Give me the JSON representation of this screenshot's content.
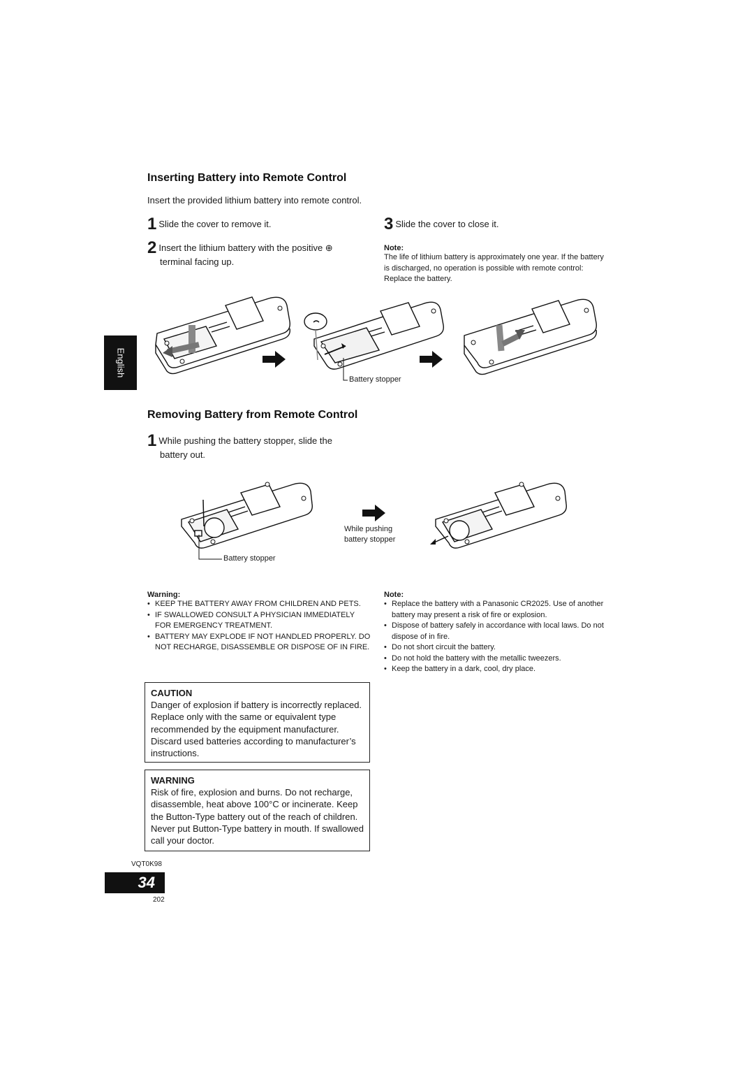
{
  "insert_section": {
    "title": "Inserting Battery into Remote Control",
    "intro": "Insert the provided lithium battery into remote control.",
    "steps": [
      {
        "num": "1",
        "text": "Slide the cover to remove it."
      },
      {
        "num": "2",
        "text_line1": "Insert the lithium battery with the positive ⊕",
        "text_line2": "terminal facing up."
      },
      {
        "num": "3",
        "text": "Slide the cover to close it."
      }
    ],
    "note": {
      "title": "Note:",
      "text": "The life of lithium battery is approximately one year. If the battery is discharged, no operation is possible with remote control: Replace the battery."
    },
    "figure_labels": {
      "battery_stopper": "Battery stopper"
    }
  },
  "language_tab": "English",
  "remove_section": {
    "title": "Removing Battery from Remote Control",
    "steps": [
      {
        "num": "1",
        "text_line1": "While pushing the battery stopper, slide the",
        "text_line2": "battery out."
      }
    ],
    "figure_labels": {
      "battery_stopper": "Battery stopper",
      "while_pushing_line1": "While pushing",
      "while_pushing_line2": "battery stopper"
    }
  },
  "warning_list": {
    "title": "Warning:",
    "items": [
      "KEEP THE BATTERY AWAY FROM CHILDREN AND PETS.",
      "IF SWALLOWED CONSULT A PHYSICIAN IMMEDIATELY FOR EMERGENCY TREATMENT.",
      "BATTERY MAY EXPLODE IF NOT HANDLED PROPERLY. DO NOT RECHARGE, DISASSEMBLE OR DISPOSE OF IN FIRE."
    ]
  },
  "note_list": {
    "title": "Note:",
    "items": [
      "Replace the battery with a Panasonic CR2025. Use of another battery may present a risk of fire or explosion.",
      "Dispose of  battery safely in accordance with local laws. Do not dispose of  in fire.",
      "Do not short circuit the battery.",
      "Do not hold the battery with the metallic tweezers.",
      "Keep the battery in a dark, cool, dry place."
    ]
  },
  "caution_box": {
    "title": "CAUTION",
    "text": "Danger of explosion if battery is incorrectly replaced. Replace only with the same or equivalent type recommended by the equipment manufacturer. Discard used batteries according to manufacturer’s instructions."
  },
  "warning_box": {
    "title": "WARNING",
    "text": "Risk of fire, explosion and burns. Do not recharge, disassemble, heat above 100°C or incinerate. Keep the Button-Type battery out of the reach of children. Never put Button-Type battery in mouth. If swallowed call your doctor."
  },
  "footer": {
    "model_code": "VQT0K98",
    "page_number": "34",
    "sub_page": "202"
  }
}
